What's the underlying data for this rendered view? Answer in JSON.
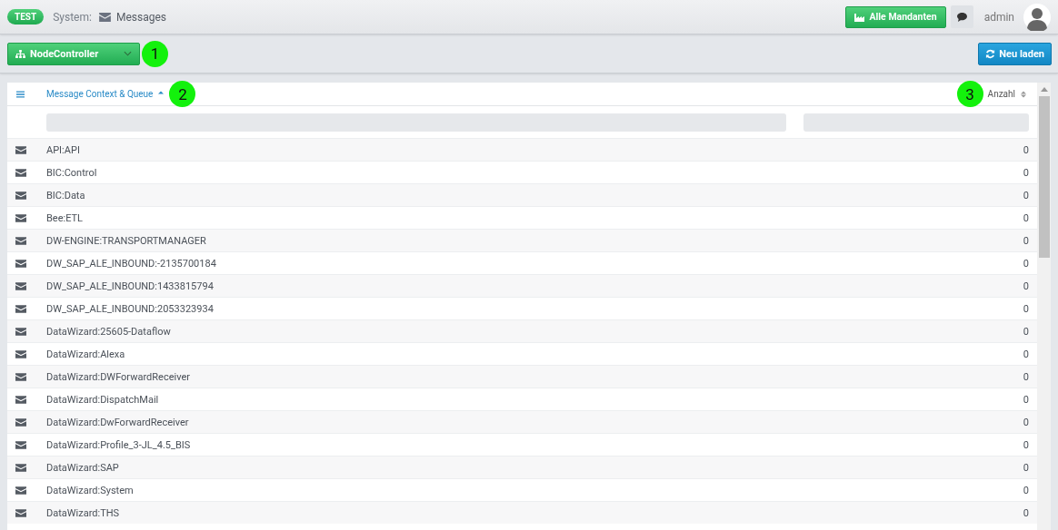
{
  "header": {
    "env_badge": "TEST",
    "system_label": "System:",
    "page_title": "Messages",
    "tenants_button": "Alle Mandanten",
    "user": "admin"
  },
  "toolbar": {
    "node_select": "NodeController",
    "reload_button": "Neu laden"
  },
  "callouts": [
    "1",
    "2",
    "3"
  ],
  "table": {
    "columns": [
      {
        "label": "Message Context & Queue",
        "sorted": true
      },
      {
        "label": "Anzahl",
        "sorted": false
      }
    ],
    "rows": [
      {
        "queue": "API:API",
        "count": "0"
      },
      {
        "queue": "BIC:Control",
        "count": "0"
      },
      {
        "queue": "BIC:Data",
        "count": "0"
      },
      {
        "queue": "Bee:ETL",
        "count": "0"
      },
      {
        "queue": "DW-ENGINE:TRANSPORTMANAGER",
        "count": "0"
      },
      {
        "queue": "DW_SAP_ALE_INBOUND:-2135700184",
        "count": "0"
      },
      {
        "queue": "DW_SAP_ALE_INBOUND:1433815794",
        "count": "0"
      },
      {
        "queue": "DW_SAP_ALE_INBOUND:2053323934",
        "count": "0"
      },
      {
        "queue": "DataWizard:25605-Dataflow",
        "count": "0"
      },
      {
        "queue": "DataWizard:Alexa",
        "count": "0"
      },
      {
        "queue": "DataWizard:DWForwardReceiver",
        "count": "0"
      },
      {
        "queue": "DataWizard:DispatchMail",
        "count": "0"
      },
      {
        "queue": "DataWizard:DwForwardReceiver",
        "count": "0"
      },
      {
        "queue": "DataWizard:Profile_3-JL_4.5_BIS",
        "count": "0"
      },
      {
        "queue": "DataWizard:SAP",
        "count": "0"
      },
      {
        "queue": "DataWizard:System",
        "count": "0"
      },
      {
        "queue": "DataWizard:THS",
        "count": "0"
      }
    ]
  }
}
